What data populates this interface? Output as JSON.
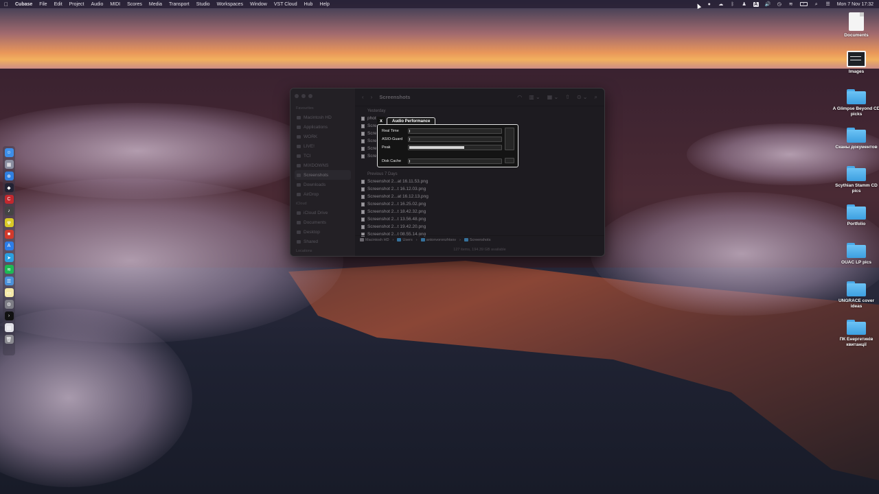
{
  "menubar": {
    "app_name": "Cubase",
    "menus": [
      "File",
      "Edit",
      "Project",
      "Audio",
      "MIDI",
      "Scores",
      "Media",
      "Transport",
      "Studio",
      "Workspaces",
      "Window",
      "VST Cloud",
      "Hub",
      "Help"
    ],
    "status_icons": [
      "cubase-status-icon",
      "cloud-icon",
      "bluetooth-icon",
      "user-icon",
      "text-input-a-icon",
      "volume-icon",
      "time-machine-icon",
      "wifi-icon",
      "battery-icon",
      "search-icon",
      "control-center-icon"
    ],
    "input_label": "A",
    "datetime": "Mon 7 Nov  17:32"
  },
  "dock": {
    "items": [
      {
        "name": "finder-dock-icon",
        "color": "#3d8ee8",
        "glyph": "☺"
      },
      {
        "name": "launchpad-dock-icon",
        "color": "#8a8ea0",
        "glyph": "▦"
      },
      {
        "name": "safari-dock-icon",
        "color": "#2f7fe0",
        "glyph": "⊕"
      },
      {
        "name": "app-dock-icon",
        "color": "#223",
        "glyph": "◆"
      },
      {
        "name": "cubase-dock-icon",
        "color": "#c2282e",
        "glyph": "C"
      },
      {
        "name": "audio-app-dock-icon",
        "color": "#444",
        "glyph": "♪"
      },
      {
        "name": "radiation-dock-icon",
        "color": "#d9c826",
        "glyph": "☢"
      },
      {
        "name": "red-app-dock-icon",
        "color": "#d33a2c",
        "glyph": "■"
      },
      {
        "name": "app-store-dock-icon",
        "color": "#2d7de8",
        "glyph": "A"
      },
      {
        "name": "telegram-dock-icon",
        "color": "#2b9fe0",
        "glyph": "➤"
      },
      {
        "name": "spotify-dock-icon",
        "color": "#1db954",
        "glyph": "≋"
      },
      {
        "name": "notes-dock-icon",
        "color": "#4a90d9",
        "glyph": "☰"
      },
      {
        "name": "stickies-dock-icon",
        "color": "#f4e8a8",
        "glyph": "▭"
      },
      {
        "name": "settings-dock-icon",
        "color": "#7d7d85",
        "glyph": "⚙"
      },
      {
        "name": "terminal-dock-icon",
        "color": "#111",
        "glyph": "›"
      },
      {
        "name": "preview-dock-icon",
        "color": "#e0e0e6",
        "glyph": "▤"
      },
      {
        "name": "trash-dock-icon",
        "color": "#8a8a90",
        "glyph": "🗑"
      }
    ]
  },
  "desktop": {
    "items": [
      {
        "label": "Documents",
        "kind": "doc"
      },
      {
        "label": "Images",
        "kind": "image"
      },
      {
        "label": "A Glimpse Beyond CD picks",
        "kind": "folder"
      },
      {
        "label": "Сканы документов",
        "kind": "folder"
      },
      {
        "label": "Scythian Stamm CD pics",
        "kind": "folder"
      },
      {
        "label": "Portfolio",
        "kind": "folder"
      },
      {
        "label": "OUAC LP pics",
        "kind": "folder"
      },
      {
        "label": "UNGRACE cover ideas",
        "kind": "folder"
      },
      {
        "label": "ПК Енергетиків квитанції",
        "kind": "folder"
      }
    ]
  },
  "finder": {
    "title": "Screenshots",
    "sidebar": {
      "favourites_label": "Favourites",
      "favourites": [
        "Macintosh HD",
        "Applications",
        "WORK",
        "LIVE!",
        "TCI",
        "MIXDOWNS",
        "Screenshots",
        "Downloads",
        "AirDrop"
      ],
      "icloud_label": "iCloud",
      "icloud": [
        "iCloud Drive",
        "Documents",
        "Desktop",
        "Shared"
      ],
      "locations_label": "Locations"
    },
    "groups": [
      {
        "label": "Yesterday",
        "files": [
          "phot",
          "Scre",
          "Scre",
          "Scre",
          "Scre",
          "Scre"
        ]
      },
      {
        "label": "Previous 7 Days",
        "files": [
          "Screenshot 2...at 16.11.53.png",
          "Screenshot 2...t 16.12.03.png",
          "Screenshot 2...at 16.12.13.png",
          "Screenshot 2...t 16.25.02.png",
          "Screenshot 2...t 18.42.32.png",
          "Screenshot 2...t 13.56.48.png",
          "Screenshot 2...t 19.42.20.png",
          "Screenshot 2...t 08.55.14.png"
        ]
      }
    ],
    "path": [
      "Macintosh HD",
      "Users",
      "antonvoronzhtsov",
      "Screenshots"
    ],
    "status": "127 items, 194.39 GB available"
  },
  "audio_performance": {
    "close_label": "x",
    "tab_label": "Audio Performance",
    "rows": [
      {
        "label": "Real Time",
        "level": 0.01
      },
      {
        "label": "ASIO-Guard",
        "level": 0.01
      },
      {
        "label": "Peak",
        "level": 0.6
      },
      {
        "label": "Disk Cache",
        "level": 0.01
      }
    ]
  }
}
